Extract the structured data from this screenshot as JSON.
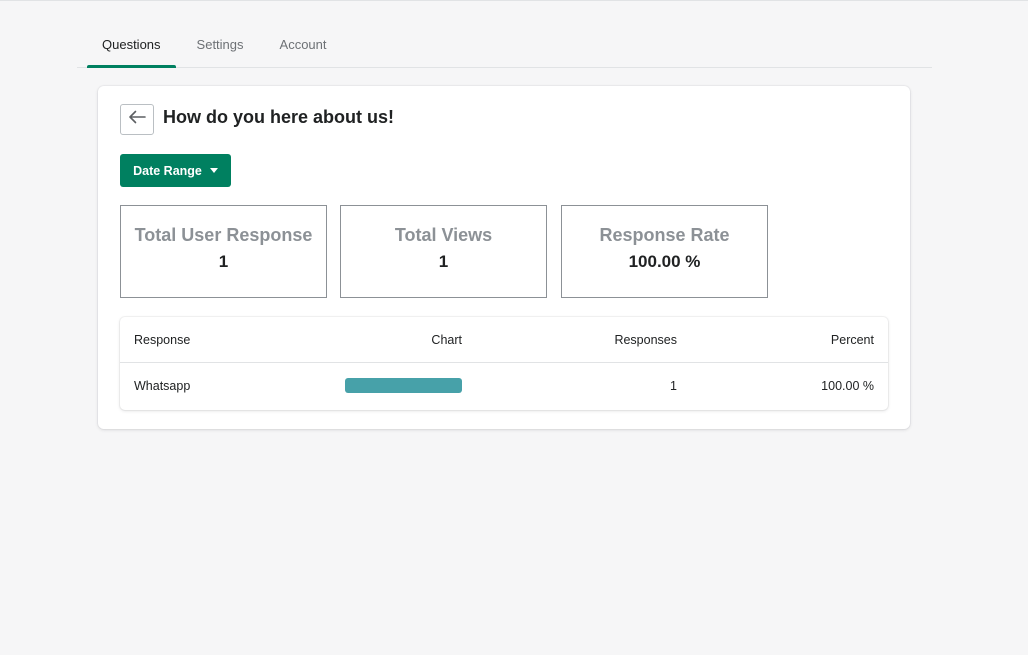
{
  "tabs": [
    {
      "label": "Questions",
      "active": true
    },
    {
      "label": "Settings",
      "active": false
    },
    {
      "label": "Account",
      "active": false
    }
  ],
  "header": {
    "back_icon": "arrow-left-icon",
    "title": "How do you here about us!"
  },
  "date_range": {
    "label": "Date Range",
    "icon": "caret-down-icon"
  },
  "stats": {
    "user_response": {
      "label": "Total User Response",
      "value": "1"
    },
    "views": {
      "label": "Total Views",
      "value": "1"
    },
    "rate": {
      "label": "Response Rate",
      "value": "100.00 %"
    }
  },
  "table": {
    "columns": [
      "Response",
      "Chart",
      "Responses",
      "Percent"
    ],
    "rows": [
      {
        "response": "Whatsapp",
        "chart_fraction": 1.0,
        "responses": "1",
        "percent": "100.00 %"
      }
    ]
  },
  "colors": {
    "accent": "#008060",
    "bar": "#47a1a9"
  }
}
